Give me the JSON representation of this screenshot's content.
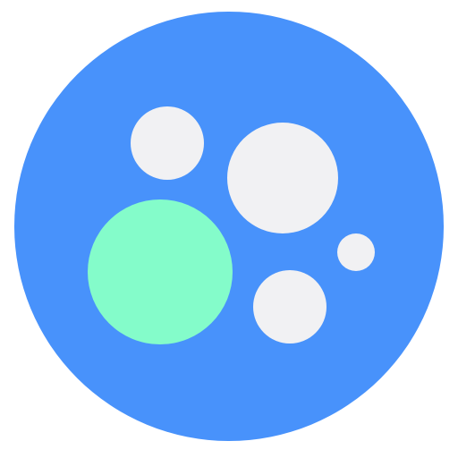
{
  "icon": {
    "name": "bubbles-app-icon",
    "colors": {
      "background": "#ffffff",
      "circle": "#4892fb",
      "bubble_light": "#f1f1f3",
      "bubble_accent": "#84fcca"
    },
    "bubbles": [
      {
        "name": "bubble-top-left",
        "color": "bubble_light"
      },
      {
        "name": "bubble-top-right-large",
        "color": "bubble_light"
      },
      {
        "name": "bubble-accent",
        "color": "bubble_accent"
      },
      {
        "name": "bubble-small-right",
        "color": "bubble_light"
      },
      {
        "name": "bubble-bottom",
        "color": "bubble_light"
      }
    ]
  }
}
